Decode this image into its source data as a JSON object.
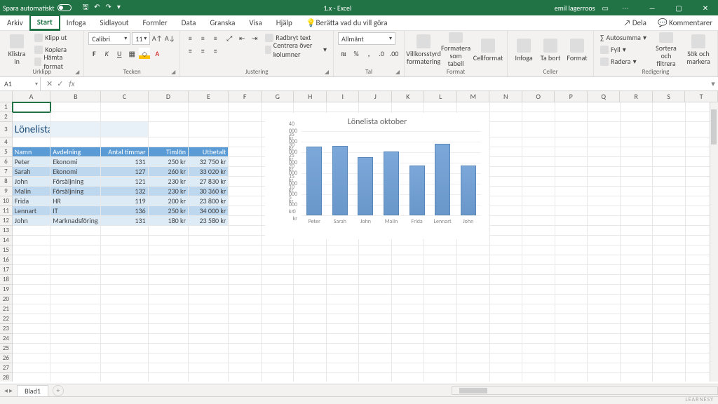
{
  "titlebar": {
    "autosave": "Spara automatiskt",
    "doc": "1.x - Excel",
    "user": "emil lagerroos"
  },
  "tabs": [
    "Arkiv",
    "Start",
    "Infoga",
    "Sidlayout",
    "Formler",
    "Data",
    "Granska",
    "Visa",
    "Hjälp"
  ],
  "tellme": "Berätta vad du vill göra",
  "share": "Dela",
  "comments": "Kommentarer",
  "ribbon": {
    "paste": "Klistra\nin",
    "cut": "Klipp ut",
    "copy": "Kopiera",
    "fmtpaint": "Hämta format",
    "g_clip": "Urklipp",
    "font": "Calibri",
    "size": "11",
    "g_font": "Tecken",
    "wrap": "Radbryt text",
    "merge": "Centrera över kolumner",
    "g_align": "Justering",
    "numfmt": "Allmänt",
    "g_num": "Tal",
    "cond": "Villkorsstyrd\nformatering",
    "tbl": "Formatera\nsom tabell",
    "cellstyle": "Cellformat",
    "g_styles": "Format",
    "insert": "Infoga",
    "delete": "Ta bort",
    "format": "Format",
    "g_cells": "Celler",
    "autosum": "Autosumma",
    "fill": "Fyll",
    "clear": "Radera",
    "sort": "Sortera och\nfiltrera",
    "find": "Sök och\nmarkera",
    "g_edit": "Redigering"
  },
  "namebox": "A1",
  "cols": [
    "A",
    "B",
    "C",
    "D",
    "E",
    "F",
    "G",
    "H",
    "I",
    "J",
    "K",
    "L",
    "M",
    "N",
    "O",
    "P",
    "Q",
    "R",
    "S",
    "T"
  ],
  "sheet": "Blad1",
  "title_text": "Lönelista Oktober",
  "headers": [
    "Namn",
    "Avdelning",
    "Antal timmar",
    "Timlön",
    "Utbetalt"
  ],
  "rows": [
    {
      "n": "Peter",
      "a": "Ekonomi",
      "t": "131",
      "l": "250 kr",
      "u": "32 750 kr"
    },
    {
      "n": "Sarah",
      "a": "Ekonomi",
      "t": "127",
      "l": "260 kr",
      "u": "33 020 kr"
    },
    {
      "n": "John",
      "a": "Försäljning",
      "t": "121",
      "l": "230 kr",
      "u": "27 830 kr"
    },
    {
      "n": "Malin",
      "a": "Försäljning",
      "t": "132",
      "l": "230 kr",
      "u": "30 360 kr"
    },
    {
      "n": "Frida",
      "a": "HR",
      "t": "119",
      "l": "200 kr",
      "u": "23 800 kr"
    },
    {
      "n": "Lennart",
      "a": "IT",
      "t": "136",
      "l": "250 kr",
      "u": "34 000 kr"
    },
    {
      "n": "John",
      "a": "Marknadsföring",
      "t": "131",
      "l": "180 kr",
      "u": "23 580 kr"
    }
  ],
  "chart_data": {
    "type": "bar",
    "title": "Lönelista oktober",
    "categories": [
      "Peter",
      "Sarah",
      "John",
      "Malin",
      "Frida",
      "Lennart",
      "John"
    ],
    "values": [
      32750,
      33020,
      27830,
      30360,
      23800,
      34000,
      23580
    ],
    "ylabels": [
      "0 kr",
      "5 000 kr",
      "10 000 kr",
      "15 000 kr",
      "20 000 kr",
      "25 000 kr",
      "30 000 kr",
      "35 000 kr",
      "40 000 kr"
    ],
    "ylim": [
      0,
      40000
    ]
  },
  "watermark": "LEARNESY"
}
